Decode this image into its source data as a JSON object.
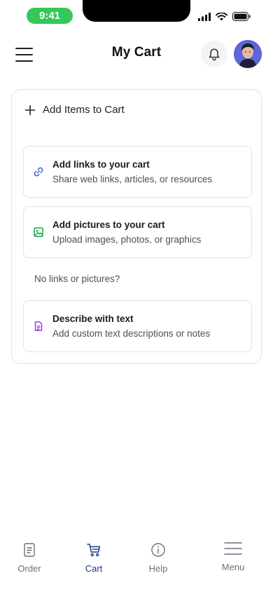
{
  "status_bar": {
    "time": "9:41"
  },
  "header": {
    "title": "My Cart"
  },
  "card": {
    "add_label": "Add Items to Cart",
    "options": [
      {
        "title": "Add links to your cart",
        "subtitle": "Share web links, articles, or resources",
        "icon": "link-icon",
        "color": "#3b5bdb"
      },
      {
        "title": "Add pictures to your cart",
        "subtitle": "Upload images, photos, or graphics",
        "icon": "image-icon",
        "color": "#16a34a"
      },
      {
        "title": "Describe with text",
        "subtitle": "Add custom text descriptions or notes",
        "icon": "document-icon",
        "color": "#9333ea"
      }
    ],
    "no_links_text": "No links or pictures?"
  },
  "bottom_nav": {
    "active": "Cart",
    "accent": "#1e3a8a",
    "items": [
      {
        "label": "Order",
        "icon": "receipt-icon"
      },
      {
        "label": "Cart",
        "icon": "cart-icon"
      },
      {
        "label": "Help",
        "icon": "info-icon"
      },
      {
        "label": "Menu",
        "icon": "menu-icon"
      }
    ]
  }
}
